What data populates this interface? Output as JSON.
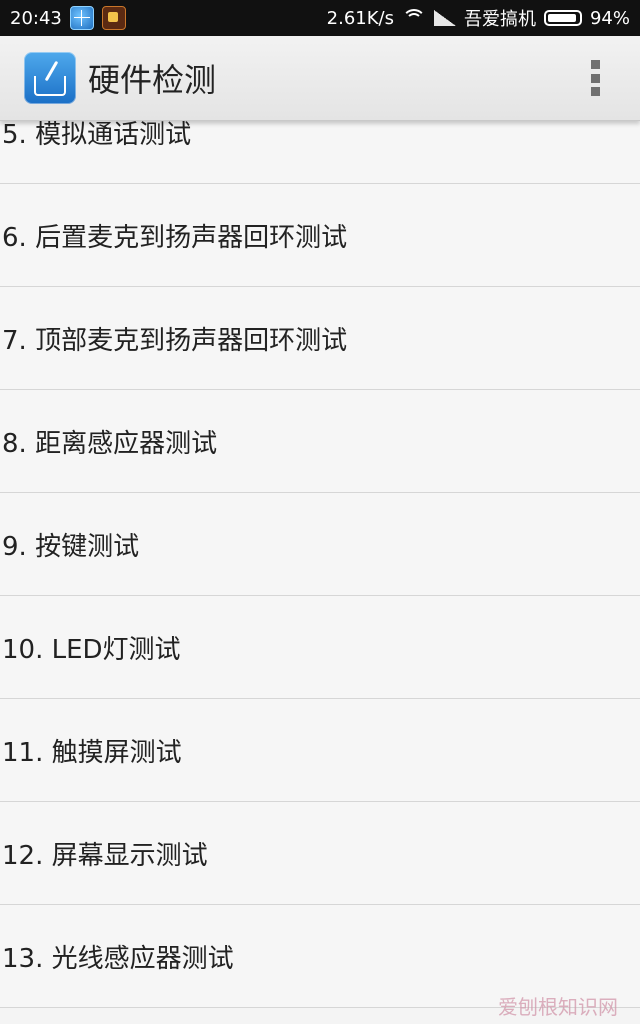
{
  "status_bar": {
    "time": "20:43",
    "net_speed": "2.61K/s",
    "carrier": "吾爱搞机",
    "battery": "94%",
    "battery_level": 0.94
  },
  "app_bar": {
    "title": "硬件检测"
  },
  "tests": [
    "5. 模拟通话测试",
    "6. 后置麦克到扬声器回环测试",
    "7. 顶部麦克到扬声器回环测试",
    "8. 距离感应器测试",
    "9. 按键测试",
    "10. LED灯测试",
    "11. 触摸屏测试",
    "12. 屏幕显示测试",
    "13. 光线感应器测试"
  ],
  "watermark": "爱刨根知识网"
}
